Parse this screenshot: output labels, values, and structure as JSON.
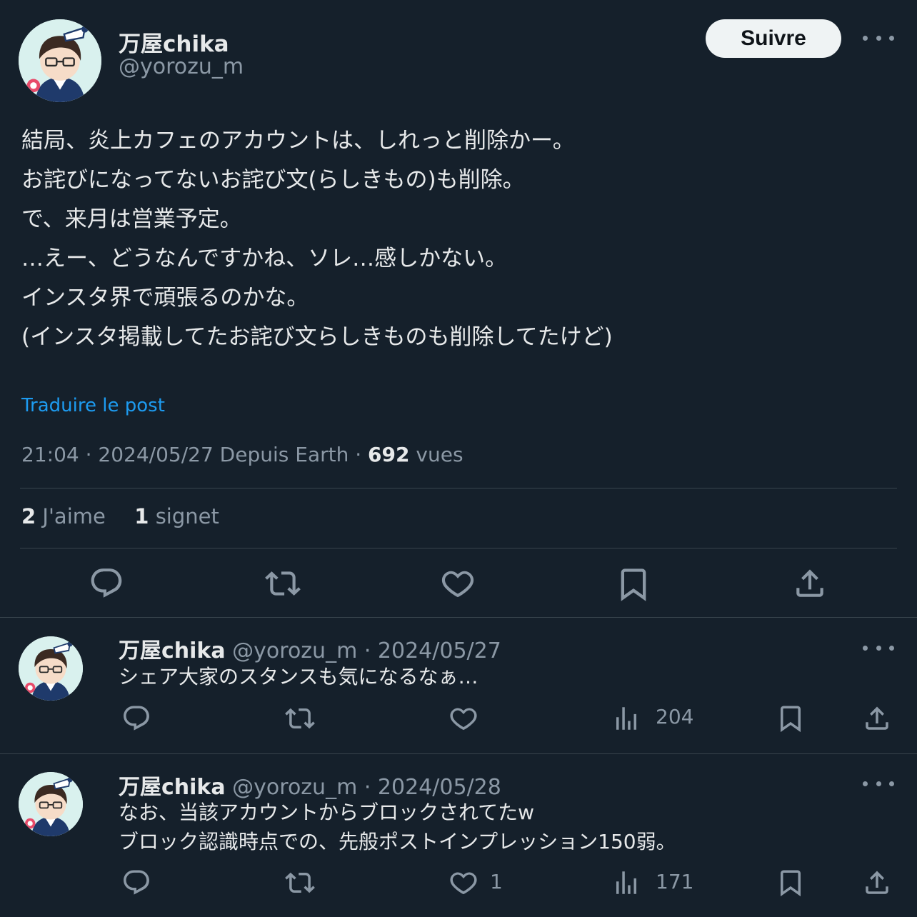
{
  "main_post": {
    "author_name": "万屋chika",
    "handle": "@yorozu_m",
    "follow_label": "Suivre",
    "text_lines": [
      "結局、炎上カフェのアカウントは、しれっと削除かー。",
      "お詫びになってないお詫び文(らしきもの)も削除。",
      "で、来月は営業予定。",
      "…えー、どうなんですかね、ソレ…感しかない。",
      "インスタ界で頑張るのかな。",
      "(インスタ掲載してたお詫び文らしきものも削除してたけど)"
    ],
    "translate_label": "Traduire le post",
    "timestamp": "21:04 · 2024/05/27 Depuis Earth · ",
    "views_count": "692",
    "views_label": " vues",
    "likes_count": "2",
    "likes_label": " J'aime",
    "bookmarks_count": "1",
    "bookmarks_label": " signet"
  },
  "replies": [
    {
      "author_name": "万屋chika",
      "handle": "@yorozu_m",
      "date": " · 2024/05/27",
      "text_lines": [
        "シェア大家のスタンスも気になるなぁ…"
      ],
      "like_count": "",
      "views": "204"
    },
    {
      "author_name": "万屋chika",
      "handle": "@yorozu_m",
      "date": " · 2024/05/28",
      "text_lines": [
        "なお、当該アカウントからブロックされてたw",
        "ブロック認識時点での、先般ポストインプレッション150弱。"
      ],
      "like_count": "1",
      "views": "171"
    }
  ],
  "colors": {
    "background": "#15202b",
    "text": "#e7e9ea",
    "muted": "#8b98a5",
    "link": "#1d9bf0",
    "divider": "#38444d"
  },
  "icons": [
    "reply-icon",
    "retweet-icon",
    "like-icon",
    "views-icon",
    "bookmark-icon",
    "share-icon",
    "more-icon"
  ]
}
